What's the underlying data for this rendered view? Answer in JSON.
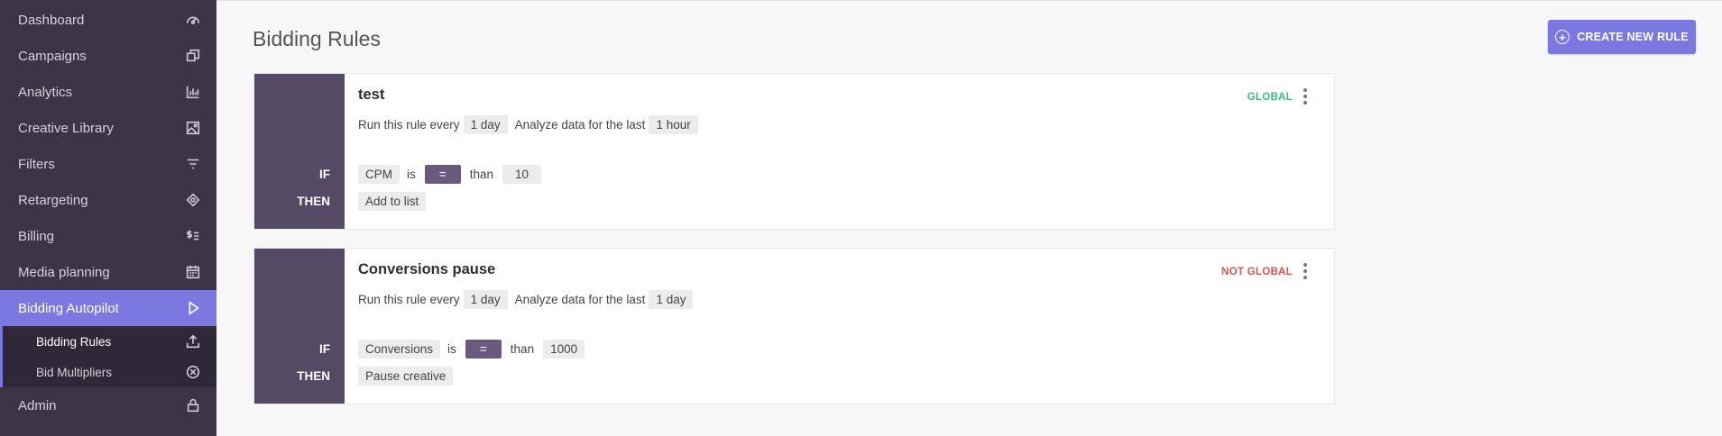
{
  "sidebar": {
    "items": [
      {
        "label": "Dashboard",
        "icon": "speedometer-icon"
      },
      {
        "label": "Campaigns",
        "icon": "copy-icon"
      },
      {
        "label": "Analytics",
        "icon": "bar-chart-icon"
      },
      {
        "label": "Creative Library",
        "icon": "image-icon"
      },
      {
        "label": "Filters",
        "icon": "filter-icon"
      },
      {
        "label": "Retargeting",
        "icon": "crosshair-icon"
      },
      {
        "label": "Billing",
        "icon": "dollar-list-icon"
      },
      {
        "label": "Media planning",
        "icon": "calendar-icon"
      },
      {
        "label": "Bidding Autopilot",
        "icon": "play-icon"
      },
      {
        "label": "Admin",
        "icon": "lock-icon"
      }
    ],
    "sub_items": [
      {
        "label": "Bidding Rules",
        "icon": "upload-icon"
      },
      {
        "label": "Bid Multipliers",
        "icon": "close-circle-icon"
      }
    ],
    "active_color": "#7b78e0",
    "bg_color": "#3d3447"
  },
  "page": {
    "title": "Bidding Rules",
    "create_button_label": "CREATE NEW RULE"
  },
  "rules": [
    {
      "name": "test",
      "scope": "GLOBAL",
      "run_text": "Run this rule every",
      "run_value": "1 day",
      "analyze_text": "Analyze data for the last",
      "analyze_value": "1 hour",
      "if_label": "IF",
      "then_label": "THEN",
      "metric": "CPM",
      "is_text": "is",
      "operator": "=",
      "than_text": "than",
      "threshold": "10",
      "action": "Add to list"
    },
    {
      "name": "Conversions pause",
      "scope": "NOT GLOBAL",
      "run_text": "Run this rule every",
      "run_value": "1 day",
      "analyze_text": "Analyze data for the last",
      "analyze_value": "1 day",
      "if_label": "IF",
      "then_label": "THEN",
      "metric": "Conversions",
      "is_text": "is",
      "operator": "=",
      "than_text": "than",
      "threshold": "1000",
      "action": "Pause creative"
    }
  ],
  "colors": {
    "global": "#3cb98a",
    "not_global": "#e0524f",
    "rule_panel": "#554a63"
  }
}
